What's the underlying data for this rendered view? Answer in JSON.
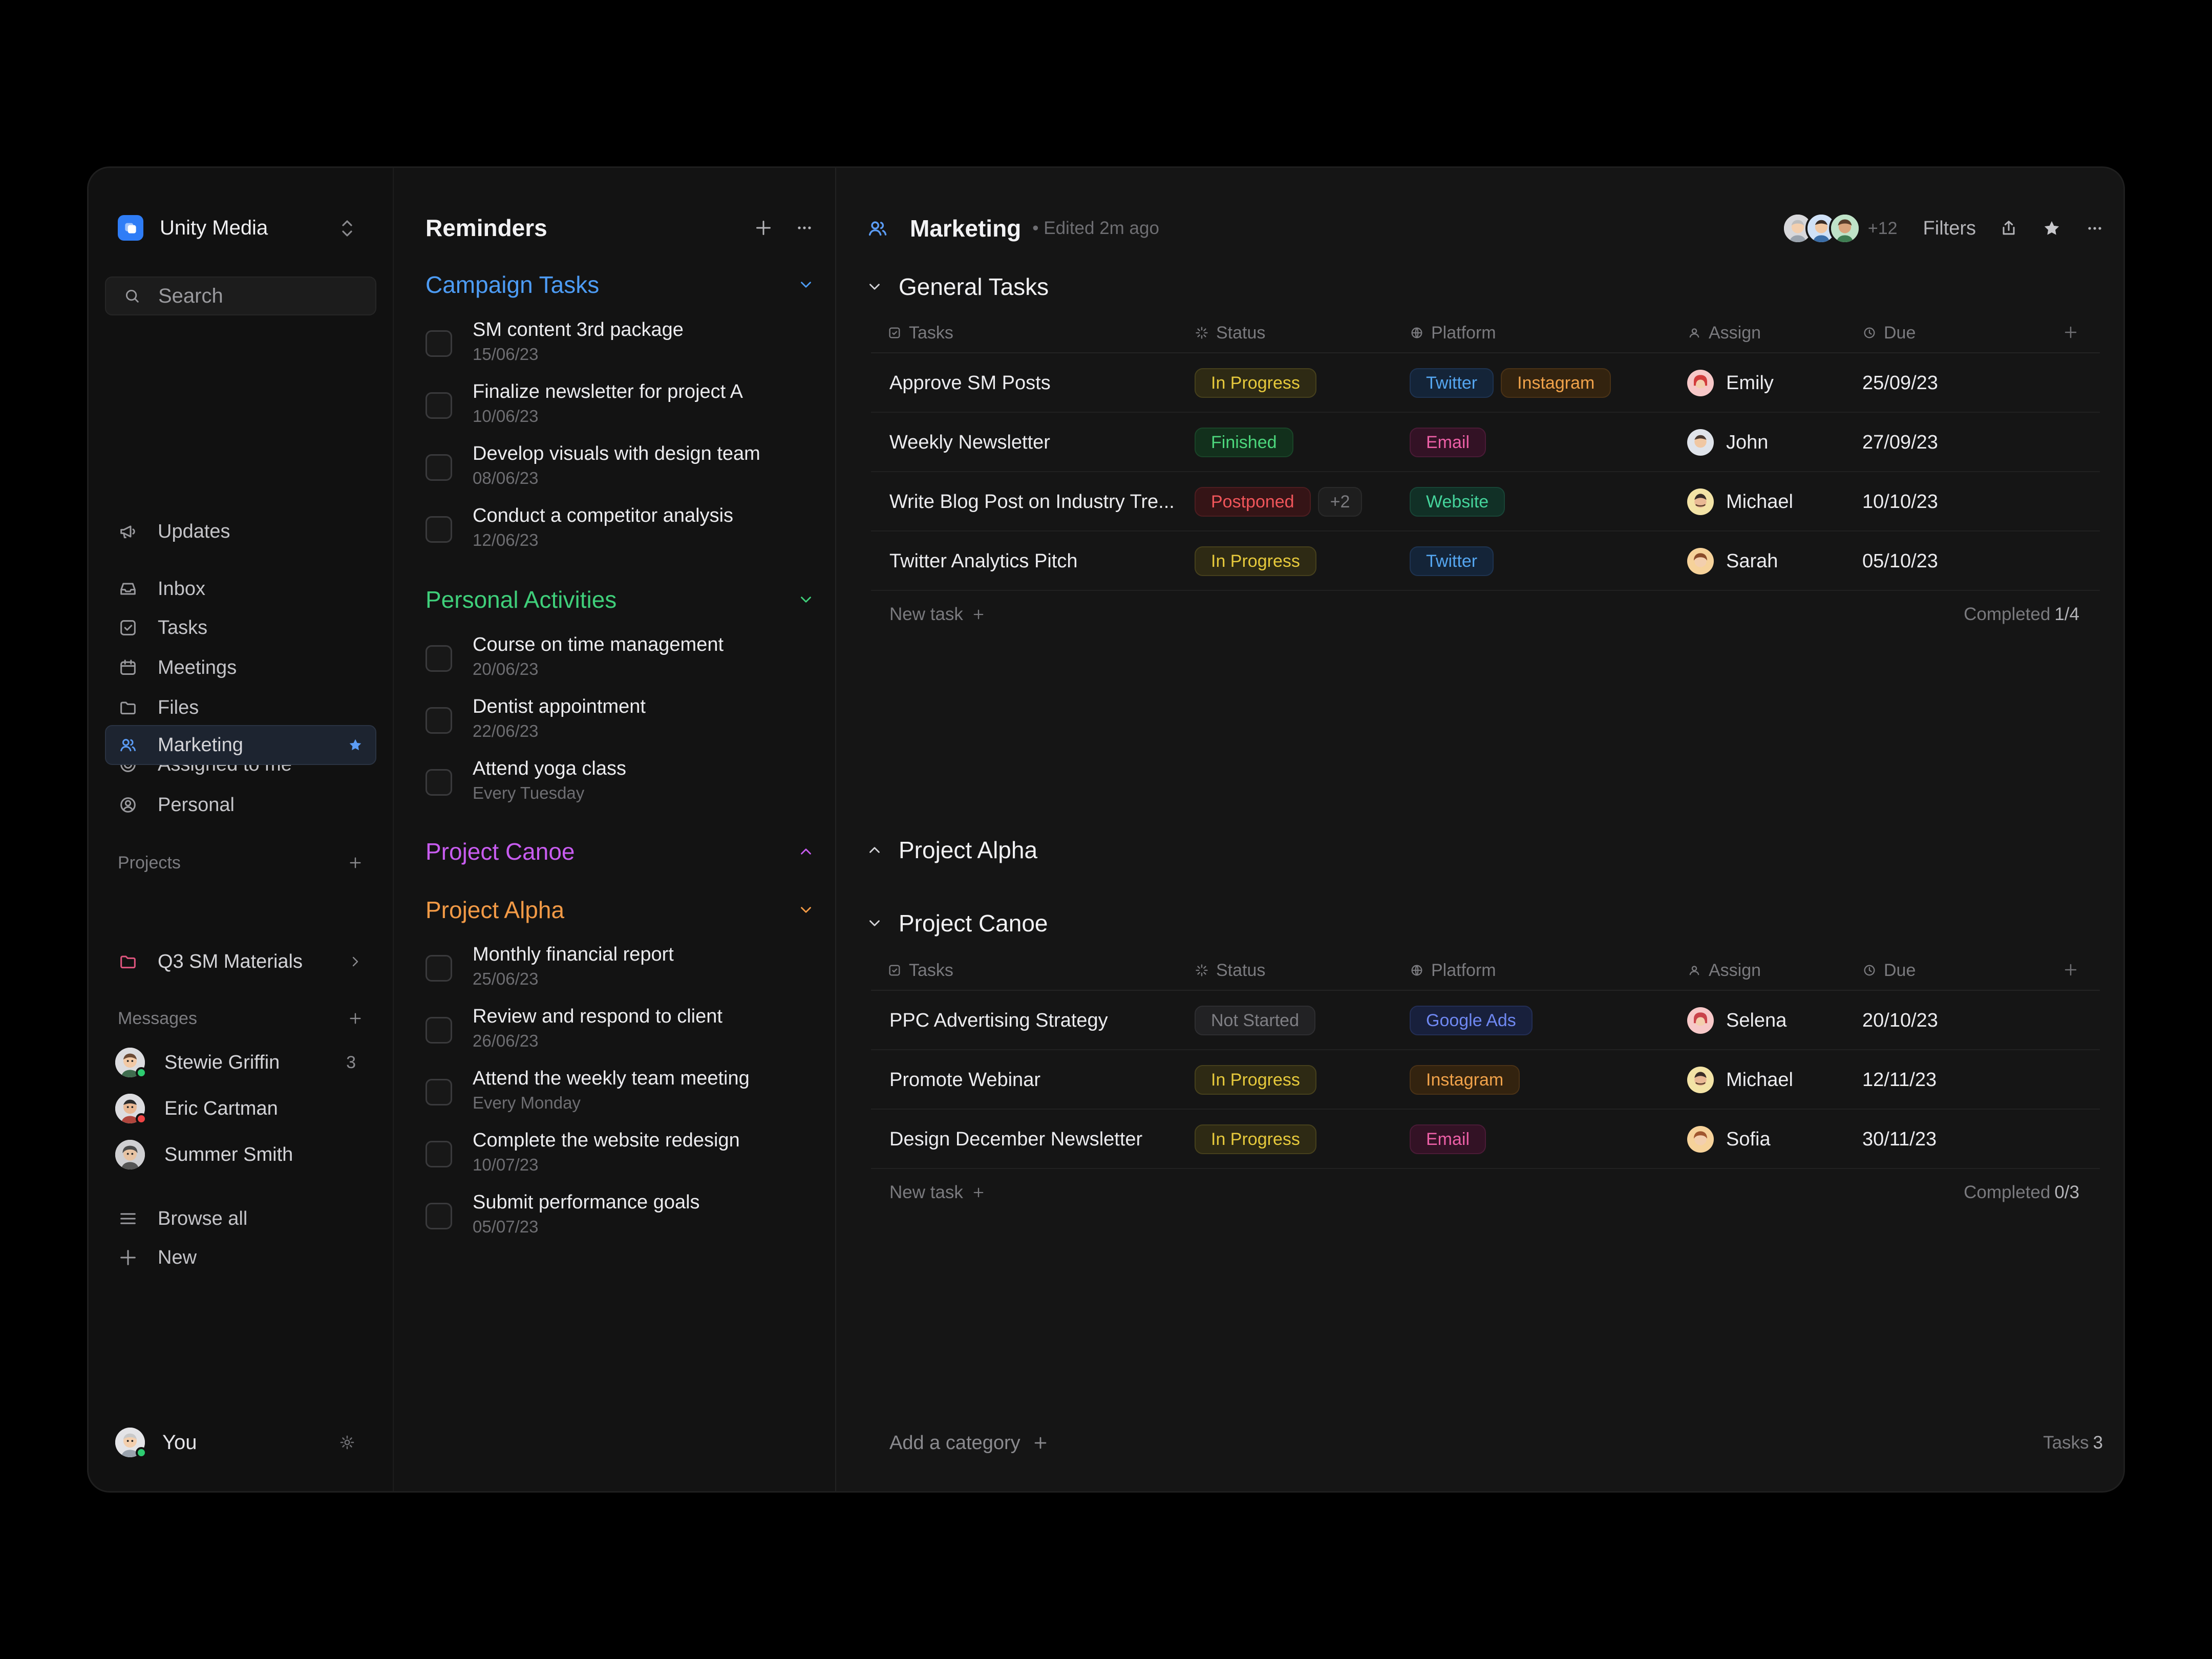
{
  "workspace": {
    "name": "Unity Media"
  },
  "search": {
    "placeholder": "Search"
  },
  "nav": {
    "updates": "Updates",
    "inbox": "Inbox",
    "tasks": "Tasks",
    "meetings": "Meetings",
    "files": "Files",
    "assigned": "Assigned to me",
    "personal": "Personal"
  },
  "projects": {
    "header": "Projects",
    "items": [
      {
        "label": "Marketing"
      },
      {
        "label": "Q3 SM Materials"
      }
    ]
  },
  "messages": {
    "header": "Messages",
    "items": [
      {
        "name": "Stewie Griffin",
        "count": "3"
      },
      {
        "name": "Eric Cartman",
        "count": ""
      },
      {
        "name": "Summer Smith",
        "count": ""
      }
    ]
  },
  "sidebar_footer": {
    "browse_all": "Browse all",
    "new": "New",
    "user": "You"
  },
  "reminders": {
    "title": "Reminders",
    "groups": [
      {
        "title": "Campaign Tasks",
        "color": "#4d9cf5",
        "items": [
          {
            "title": "SM content 3rd package",
            "date": "15/06/23"
          },
          {
            "title": "Finalize newsletter for project A",
            "date": "10/06/23"
          },
          {
            "title": "Develop visuals with design team",
            "date": "08/06/23"
          },
          {
            "title": "Conduct a competitor analysis",
            "date": "12/06/23"
          }
        ]
      },
      {
        "title": "Personal Activities",
        "color": "#3fcf7a",
        "items": [
          {
            "title": "Course on time management",
            "date": "20/06/23"
          },
          {
            "title": "Dentist appointment",
            "date": "22/06/23"
          },
          {
            "title": "Attend yoga class",
            "date": "Every Tuesday"
          }
        ]
      },
      {
        "title": "Project Canoe",
        "color": "#c85cf0",
        "items": []
      },
      {
        "title": "Project Alpha",
        "color": "#f29a46",
        "items": [
          {
            "title": "Monthly financial report",
            "date": "25/06/23"
          },
          {
            "title": "Review and respond to client",
            "date": "26/06/23"
          },
          {
            "title": "Attend the weekly team meeting",
            "date": "Every Monday"
          },
          {
            "title": "Complete the website redesign",
            "date": "10/07/23"
          },
          {
            "title": "Submit performance goals",
            "date": "05/07/23"
          }
        ]
      }
    ]
  },
  "main": {
    "title": "Marketing",
    "edited": "• Edited 2m ago",
    "more_members": "+12",
    "filters": "Filters",
    "columns": {
      "tasks": "Tasks",
      "status": "Status",
      "platform": "Platform",
      "assign": "Assign",
      "due": "Due"
    },
    "categories": [
      {
        "title": "General Tasks",
        "rows": [
          {
            "task": "Approve SM Posts",
            "status": "In Progress",
            "platforms": [
              "Twitter",
              "Instagram"
            ],
            "assignee": "Emily",
            "due": "25/09/23"
          },
          {
            "task": "Weekly Newsletter",
            "status": "Finished",
            "platforms": [
              "Email"
            ],
            "assignee": "John",
            "due": "27/09/23"
          },
          {
            "task": "Write Blog Post on Industry Tre...",
            "status": "Postponed",
            "extra": "+2",
            "platforms": [
              "Website"
            ],
            "assignee": "Michael",
            "due": "10/10/23"
          },
          {
            "task": "Twitter Analytics Pitch",
            "status": "In Progress",
            "platforms": [
              "Twitter"
            ],
            "assignee": "Sarah",
            "due": "05/10/23"
          }
        ],
        "new_task": "New task",
        "completed_label": "Completed",
        "completed_value": "1/4"
      },
      {
        "title": "Project Alpha"
      },
      {
        "title": "Project Canoe",
        "rows": [
          {
            "task": "PPC Advertising Strategy",
            "status": "Not Started",
            "platforms": [
              "Google Ads"
            ],
            "assignee": "Selena",
            "due": "20/10/23"
          },
          {
            "task": "Promote Webinar",
            "status": "In Progress",
            "platforms": [
              "Instagram"
            ],
            "assignee": "Michael",
            "due": "12/11/23"
          },
          {
            "task": "Design December Newsletter",
            "status": "In Progress",
            "platforms": [
              "Email"
            ],
            "assignee": "Sofia",
            "due": "30/11/23"
          }
        ],
        "new_task": "New task",
        "completed_label": "Completed",
        "completed_value": "0/3"
      }
    ],
    "add_category": "Add a category",
    "tasks_label": "Tasks",
    "tasks_count": "3"
  }
}
